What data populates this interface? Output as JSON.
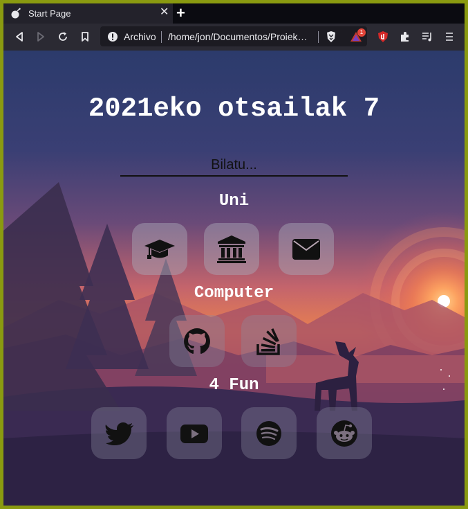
{
  "browser": {
    "tab_title": "Start Page",
    "new_tab_label": "+",
    "url_scheme_label": "Archivo",
    "url": "/home/jon/Documentos/Proiek…",
    "rewards_badge": "1"
  },
  "page": {
    "date": "2021eko otsailak 7",
    "search_placeholder": "Bilatu...",
    "categories": [
      {
        "label": "Uni",
        "links": [
          "graduation-cap-icon",
          "university-icon",
          "envelope-icon"
        ]
      },
      {
        "label": "Computer",
        "links": [
          "github-icon",
          "stack-overflow-icon"
        ]
      },
      {
        "label": "4 Fun",
        "links": [
          "twitter-icon",
          "youtube-icon",
          "spotify-icon",
          "reddit-icon"
        ]
      }
    ]
  },
  "colors": {
    "frame": "#8a9a10",
    "toolbar": "#2b2a33",
    "urlbar": "#1c1b22",
    "sky_top": "#2a3a6e",
    "sunset": "#f08040"
  }
}
